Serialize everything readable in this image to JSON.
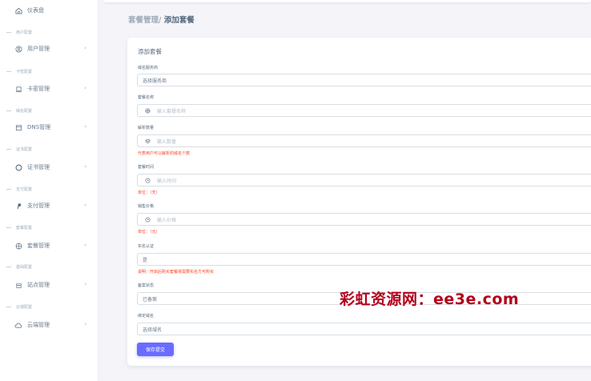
{
  "sidebar": {
    "dashboard": {
      "label": "仪表盘",
      "icon": "home-icon"
    },
    "sections": [
      {
        "header": "用户配置",
        "item": {
          "label": "用户管理",
          "icon": "user-icon"
        }
      },
      {
        "header": "卡密配置",
        "item": {
          "label": "卡密管理",
          "icon": "laptop-icon"
        }
      },
      {
        "header": "域名配置",
        "item": {
          "label": "DNS管理",
          "icon": "calendar-icon"
        }
      },
      {
        "header": "证书配置",
        "item": {
          "label": "证书管理",
          "icon": "circle-icon"
        }
      },
      {
        "header": "支付配置",
        "item": {
          "label": "支付管理",
          "icon": "paypal-icon"
        }
      },
      {
        "header": "套餐配置",
        "item": {
          "label": "套餐管理",
          "icon": "package-icon"
        }
      },
      {
        "header": "基础配置",
        "item": {
          "label": "站点管理",
          "icon": "store-icon"
        }
      },
      {
        "header": "云端配置",
        "item": {
          "label": "云端管理",
          "icon": "cloud-icon"
        }
      }
    ]
  },
  "breadcrumb": {
    "parent": "套餐管理/",
    "current": " 添加套餐"
  },
  "card": {
    "title": "添加套餐",
    "fields": [
      {
        "label": "域名服务商",
        "value": "选择服务商",
        "placeholder": ""
      },
      {
        "label": "套餐名称",
        "value": "",
        "placeholder": "输入套餐名称",
        "icon": "package-icon"
      },
      {
        "label": "解析数量",
        "value": "",
        "placeholder": "输入数量",
        "icon": "layers-icon",
        "help": "代表用户可以解析的域名个数"
      },
      {
        "label": "套餐时间",
        "value": "",
        "placeholder": "输入时间",
        "icon": "clock-icon",
        "help": "单位：（天）"
      },
      {
        "label": "销售价格",
        "value": "",
        "placeholder": "输入价格",
        "icon": "clock-icon",
        "help": "单位：（元）"
      },
      {
        "label": "实名认证",
        "value": "是",
        "placeholder": "",
        "help": "说明：开启后购买套餐将需要实名方可购买"
      },
      {
        "label": "备案状态",
        "value": "已备案",
        "placeholder": ""
      },
      {
        "label": "绑定域名",
        "value": "选择域名",
        "placeholder": ""
      }
    ],
    "submit_label": "保存提交"
  },
  "watermark": "彩虹资源网：ee3e.com",
  "colors": {
    "primary": "#696cff",
    "danger": "#ff3e1d",
    "text": "#566a7f",
    "background": "#f5f5f9",
    "watermark": "#b3001b"
  }
}
